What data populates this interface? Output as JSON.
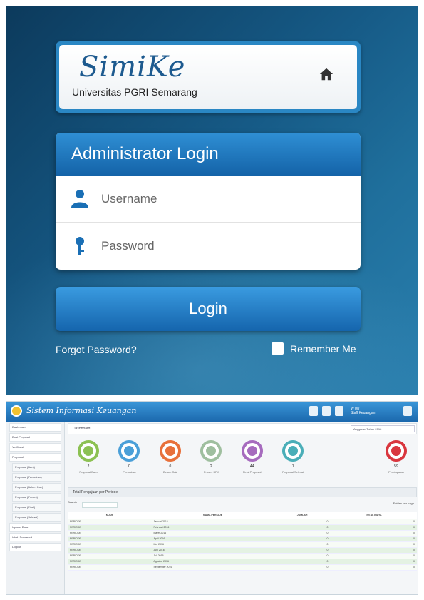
{
  "login": {
    "logo_text": "SimiKe",
    "university": "Universitas PGRI Semarang",
    "header": "Administrator Login",
    "username_placeholder": "Username",
    "password_placeholder": "Password",
    "login_button": "Login",
    "forgot_link": "Forgot Password?",
    "remember_label": "Remember Me",
    "colors": {
      "accent": "#1a6fb5",
      "background": "#165a86"
    }
  },
  "dashboard": {
    "app_title": "Sistem Informasi Keuangan",
    "user_name": "WTW",
    "user_role": "Staff Keuangan",
    "sidebar": [
      {
        "label": "Dashboard",
        "sub": false
      },
      {
        "label": "Buat Proposal",
        "sub": false
      },
      {
        "label": "Verifikasi",
        "sub": false
      },
      {
        "label": "Proposal",
        "sub": false
      },
      {
        "label": "Proposal (Baru)",
        "sub": true
      },
      {
        "label": "Proposal (Pencairan)",
        "sub": true
      },
      {
        "label": "Proposal (Belum Cair)",
        "sub": true
      },
      {
        "label": "Proposal (Proses)",
        "sub": true
      },
      {
        "label": "Proposal (Final)",
        "sub": true
      },
      {
        "label": "Proposal (Selesai)",
        "sub": true
      },
      {
        "label": "Upload Data",
        "sub": false
      },
      {
        "label": "Ubah Password",
        "sub": false
      },
      {
        "label": "Logout",
        "sub": false
      }
    ],
    "breadcrumb": "Dashboard",
    "year_select": "Anggaran Tahun 2016",
    "stats": [
      {
        "value": "2",
        "label": "Proposal Baru",
        "color": "#8cc152"
      },
      {
        "value": "0",
        "label": "Pencairan",
        "color": "#4a9fd8"
      },
      {
        "value": "0",
        "label": "Belum Cair",
        "color": "#e8703a"
      },
      {
        "value": "2",
        "label": "Proses SPJ",
        "color": "#9fbf9f"
      },
      {
        "value": "44",
        "label": "Final Proposal",
        "color": "#a66bbe"
      },
      {
        "value": "1",
        "label": "Proposal Selesai",
        "color": "#4aaeb8"
      },
      {
        "value": "59",
        "label": "Pendapatan",
        "color": "#d9363e"
      }
    ],
    "section_title": "Total Pengajuan per Periode",
    "search_label": "Search",
    "page_size_label": "Entries per page",
    "table_headers": [
      "KODE",
      "NAMA PERIODE",
      "JUMLAH",
      "TOTAL BIAYA"
    ],
    "table_rows": [
      [
        "PERIODE",
        "Januari 2016",
        "0",
        "0"
      ],
      [
        "PERIODE",
        "Februari 2016",
        "0",
        "0"
      ],
      [
        "PERIODE",
        "Maret 2016",
        "0",
        "0"
      ],
      [
        "PERIODE",
        "April 2016",
        "0",
        "0"
      ],
      [
        "PERIODE",
        "Mei 2016",
        "0",
        "0"
      ],
      [
        "PERIODE",
        "Juni 2016",
        "0",
        "0"
      ],
      [
        "PERIODE",
        "Juli 2016",
        "0",
        "0"
      ],
      [
        "PERIODE",
        "Agustus 2016",
        "0",
        "0"
      ],
      [
        "PERIODE",
        "September 2016",
        "0",
        "0"
      ]
    ]
  }
}
